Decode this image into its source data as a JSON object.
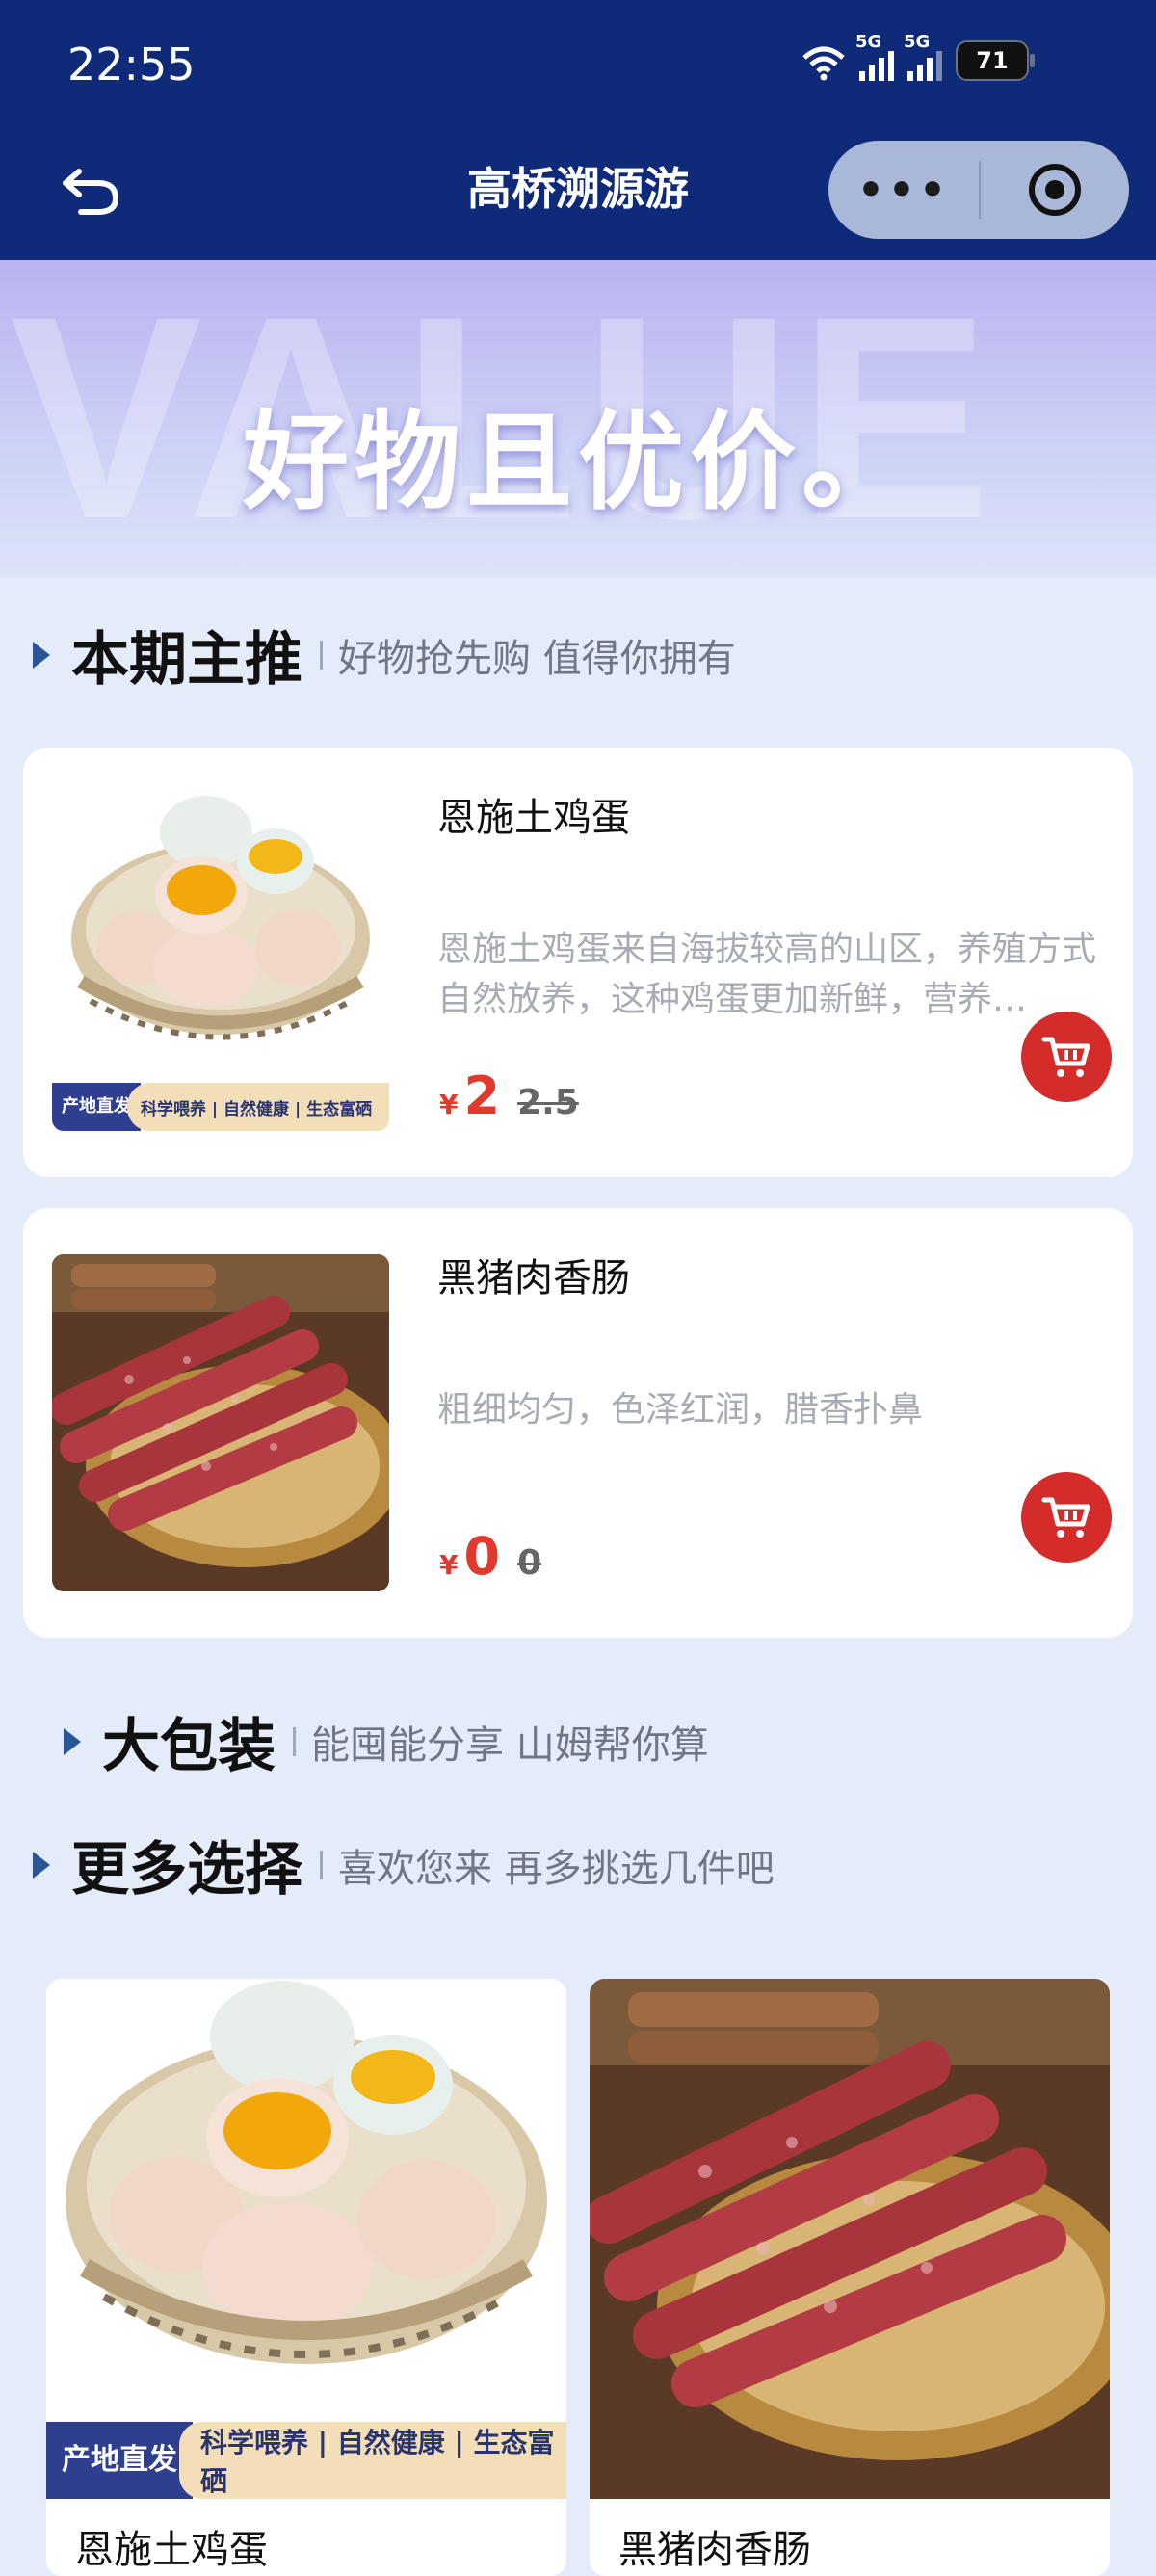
{
  "status_bar": {
    "time": "22:55",
    "network_a": "5G",
    "network_b": "5G",
    "battery": "71"
  },
  "nav": {
    "title": "高桥溯源游",
    "more_label": "•••"
  },
  "banner": {
    "watermark": "VALUE",
    "title": "好物且优价。"
  },
  "sections": {
    "featured": {
      "title": "本期主推",
      "subtitle": "好物抢先购 值得你拥有"
    },
    "bulk": {
      "title": "大包装",
      "subtitle": "能囤能分享 山姆帮你算"
    },
    "more": {
      "title": "更多选择",
      "subtitle": "喜欢您来 再多挑选几件吧"
    }
  },
  "products": [
    {
      "name": "恩施土鸡蛋",
      "desc": "恩施土鸡蛋来自海拔较高的山区，养殖方式自然放养，这种鸡蛋更加新鲜，营养…",
      "currency": "¥",
      "price": "2",
      "old_price": "2.5",
      "ribbon_left": "产地直发",
      "ribbon_right": "科学喂养 | 自然健康 | 生态富硒"
    },
    {
      "name": "黑猪肉香肠",
      "desc": "粗细均匀，色泽红润，腊香扑鼻",
      "currency": "¥",
      "price": "0",
      "old_price": "0"
    }
  ],
  "grid": [
    {
      "name": "恩施土鸡蛋",
      "ribbon_left": "产地直发",
      "ribbon_right": "科学喂养 | 自然健康 | 生态富硒"
    },
    {
      "name": "黑猪肉香肠"
    }
  ],
  "colors": {
    "nav_bg": "#0f2a78",
    "price_red": "#e03a2f",
    "cart_red": "#d42b2b",
    "page_bg": "#e4ebf9"
  }
}
